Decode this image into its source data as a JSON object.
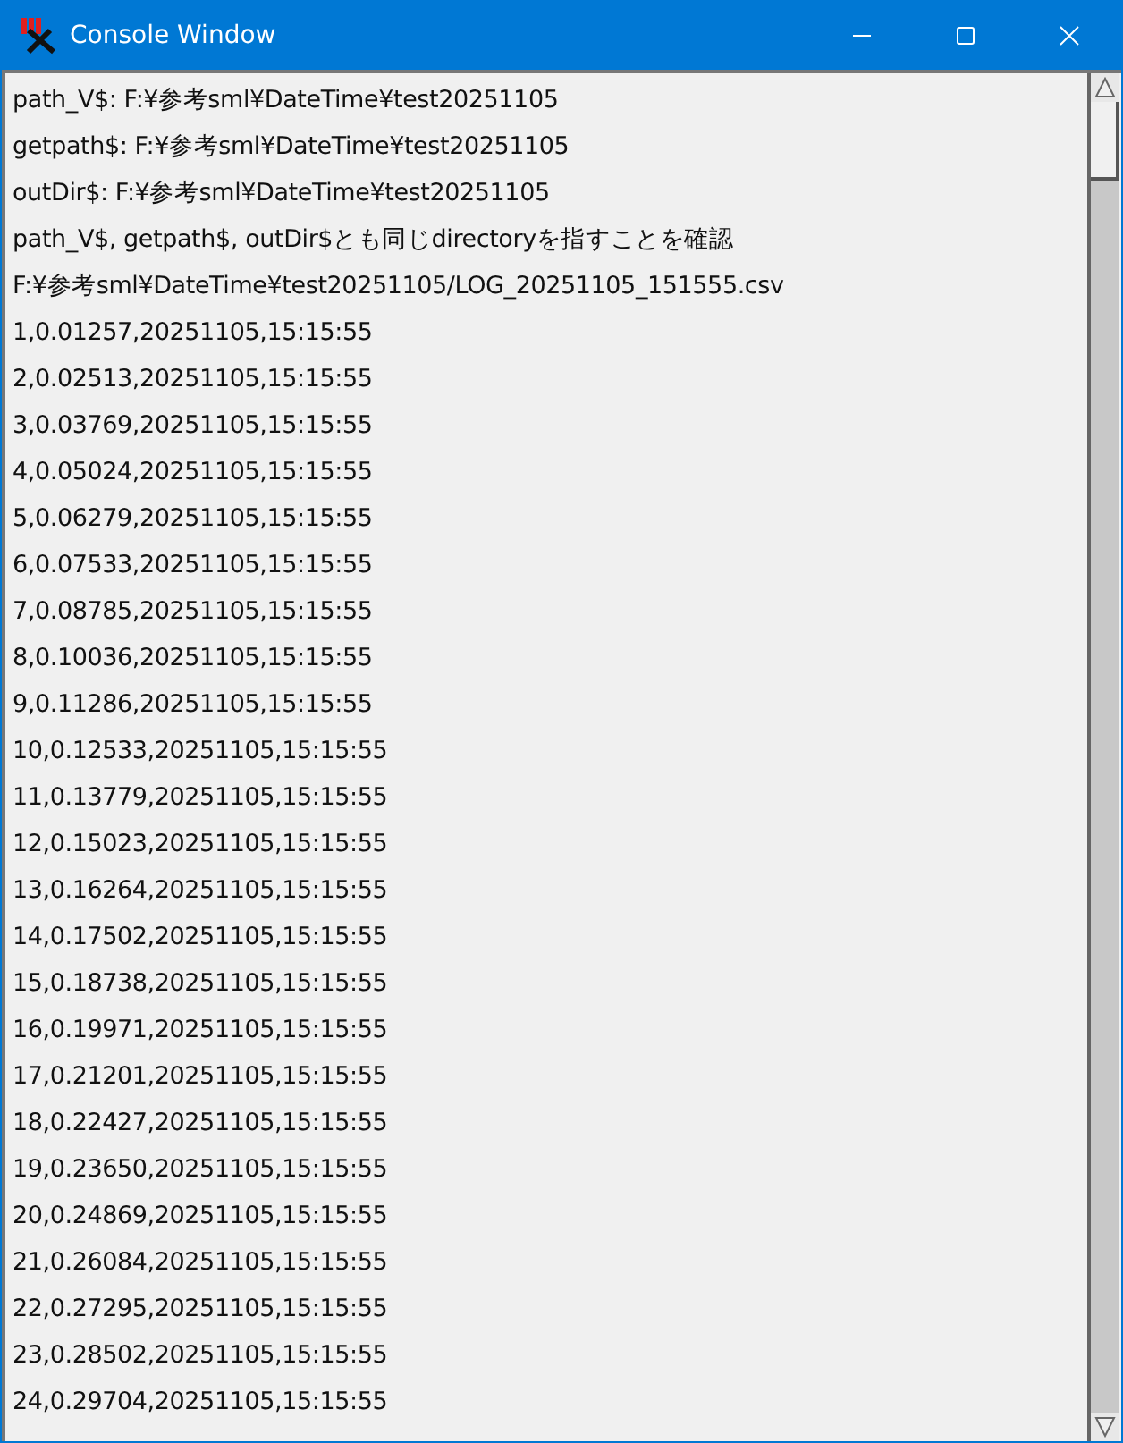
{
  "window": {
    "title": "Console Window"
  },
  "console": {
    "lines": [
      "path_V$: F:¥参考sml¥DateTime¥test20251105",
      "getpath$: F:¥参考sml¥DateTime¥test20251105",
      "outDir$: F:¥参考sml¥DateTime¥test20251105",
      "path_V$, getpath$, outDir$とも同じdirectoryを指すことを確認",
      "F:¥参考sml¥DateTime¥test20251105/LOG_20251105_151555.csv",
      "1,0.01257,20251105,15:15:55",
      "2,0.02513,20251105,15:15:55",
      "3,0.03769,20251105,15:15:55",
      "4,0.05024,20251105,15:15:55",
      "5,0.06279,20251105,15:15:55",
      "6,0.07533,20251105,15:15:55",
      "7,0.08785,20251105,15:15:55",
      "8,0.10036,20251105,15:15:55",
      "9,0.11286,20251105,15:15:55",
      "10,0.12533,20251105,15:15:55",
      "11,0.13779,20251105,15:15:55",
      "12,0.15023,20251105,15:15:55",
      "13,0.16264,20251105,15:15:55",
      "14,0.17502,20251105,15:15:55",
      "15,0.18738,20251105,15:15:55",
      "16,0.19971,20251105,15:15:55",
      "17,0.21201,20251105,15:15:55",
      "18,0.22427,20251105,15:15:55",
      "19,0.23650,20251105,15:15:55",
      "20,0.24869,20251105,15:15:55",
      "21,0.26084,20251105,15:15:55",
      "22,0.27295,20251105,15:15:55",
      "23,0.28502,20251105,15:15:55",
      "24,0.29704,20251105,15:15:55"
    ]
  }
}
